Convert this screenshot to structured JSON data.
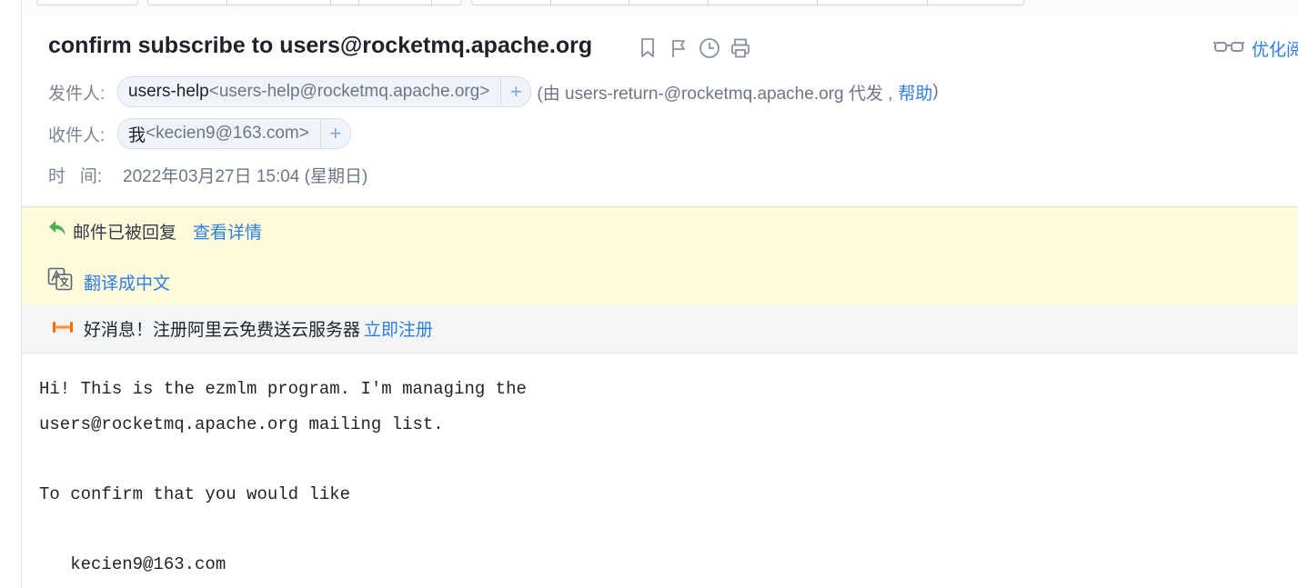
{
  "subject": "confirm subscribe to users@rocketmq.apache.org",
  "subject_icons": [
    "bookmark-icon",
    "flag-icon",
    "clock-icon",
    "printer-icon"
  ],
  "reader_mode": {
    "icon": "glasses-icon",
    "label": "优化阅"
  },
  "from": {
    "label": "发件人:",
    "name": "users-help",
    "address": "<users-help@rocketmq.apache.org>",
    "add_label": "+",
    "via_prefix": "(由 users-return-@rocketmq.apache.org 代发 ,",
    "help_link": "帮助",
    "via_suffix": ")"
  },
  "to": {
    "label": "收件人:",
    "name": "我",
    "address": "<kecien9@163.com>",
    "add_label": "+"
  },
  "time": {
    "label": "时   间:",
    "value": "2022年03月27日 15:04 (星期日)"
  },
  "notice": {
    "replied_text": "邮件已被回复",
    "replied_link": "查看详情",
    "translate_link": "翻译成中文",
    "colors": {
      "reply_icon": "#4caf50",
      "link": "#2f7ee0",
      "banner": "#fefbdc"
    }
  },
  "ad": {
    "text": "好消息！注册阿里云免费送云服务器",
    "link": "立即注册"
  },
  "body_lines": [
    "Hi! This is the ezmlm program. I'm managing the",
    "users@rocketmq.apache.org mailing list.",
    "",
    "To confirm that you would like",
    "",
    "   kecien9@163.com"
  ]
}
